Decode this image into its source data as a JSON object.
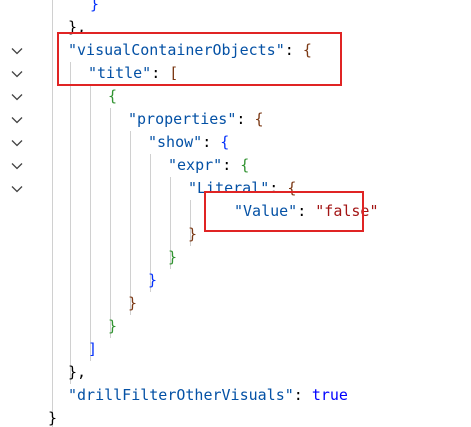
{
  "editor": {
    "lines": [
      {
        "text": "}",
        "cls": "p1"
      },
      {
        "text": "},",
        "cls": "punc"
      },
      {
        "key": "\"visualContainerObjects\"",
        "sep": ": ",
        "open": "{",
        "openCls": "p3"
      },
      {
        "key": "\"title\"",
        "sep": ": ",
        "open": "[",
        "openCls": "p3"
      },
      {
        "text": "{",
        "cls": "p2"
      },
      {
        "key": "\"properties\"",
        "sep": ": ",
        "open": "{",
        "openCls": "p3"
      },
      {
        "key": "\"show\"",
        "sep": ": ",
        "open": "{",
        "openCls": "p1"
      },
      {
        "key": "\"expr\"",
        "sep": ": ",
        "open": "{",
        "openCls": "p2"
      },
      {
        "key": "\"Literal\"",
        "sep": ": ",
        "open": "{",
        "openCls": "p3"
      },
      {
        "key": "\"Value\"",
        "sep": ": ",
        "value": "\"false\"",
        "valueCls": "str"
      },
      {
        "text": "}",
        "cls": "p3"
      },
      {
        "text": "}",
        "cls": "p2"
      },
      {
        "text": "}",
        "cls": "p1"
      },
      {
        "text": "}",
        "cls": "p3"
      },
      {
        "text": "}",
        "cls": "p2"
      },
      {
        "text": "]",
        "cls": "p1"
      },
      {
        "text": "},",
        "cls": "punc"
      },
      {
        "key": "\"drillFilterOtherVisuals\"",
        "sep": ": ",
        "value": "true",
        "valueCls": "kw"
      },
      {
        "text": "}",
        "cls": "punc"
      }
    ],
    "fold_icon": "chevron-down-icon",
    "highlight_color": "#e02424"
  }
}
